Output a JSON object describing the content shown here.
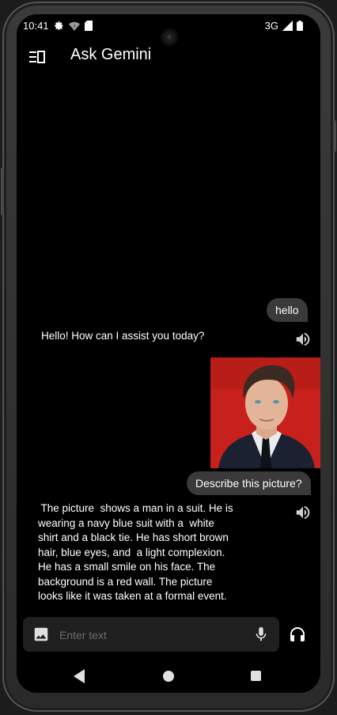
{
  "status_bar": {
    "time": "10:41",
    "network": "3G"
  },
  "app_bar": {
    "title": "Ask Gemini"
  },
  "messages": {
    "user_1": "hello",
    "bot_1": "Hello! How can I assist you today?",
    "user_2": "Describe this picture?",
    "bot_2_lines": [
      " The picture  shows a man in a suit. He is",
      "wearing a navy blue suit with a  white",
      "shirt and a black tie. He has short brown",
      "hair, blue eyes, and  a light complexion.",
      "He has a small smile on his face. The",
      "background is a red wall. The picture",
      "looks like it was taken at a formal event."
    ]
  },
  "input": {
    "placeholder": "Enter text",
    "value": ""
  },
  "icons": {
    "menu": "menu-icon",
    "image": "image-icon",
    "mic": "mic-icon",
    "headset": "headset-icon",
    "speaker": "speaker-icon",
    "settings": "gear-icon",
    "wifi": "wifi-icon",
    "sim": "sim-icon",
    "signal": "signal-icon",
    "battery": "battery-icon"
  },
  "colors": {
    "background": "#000000",
    "user_bubble": "#3a3a3a",
    "input_bg": "#1f1f1f",
    "photo_bg": "#c8201c"
  }
}
